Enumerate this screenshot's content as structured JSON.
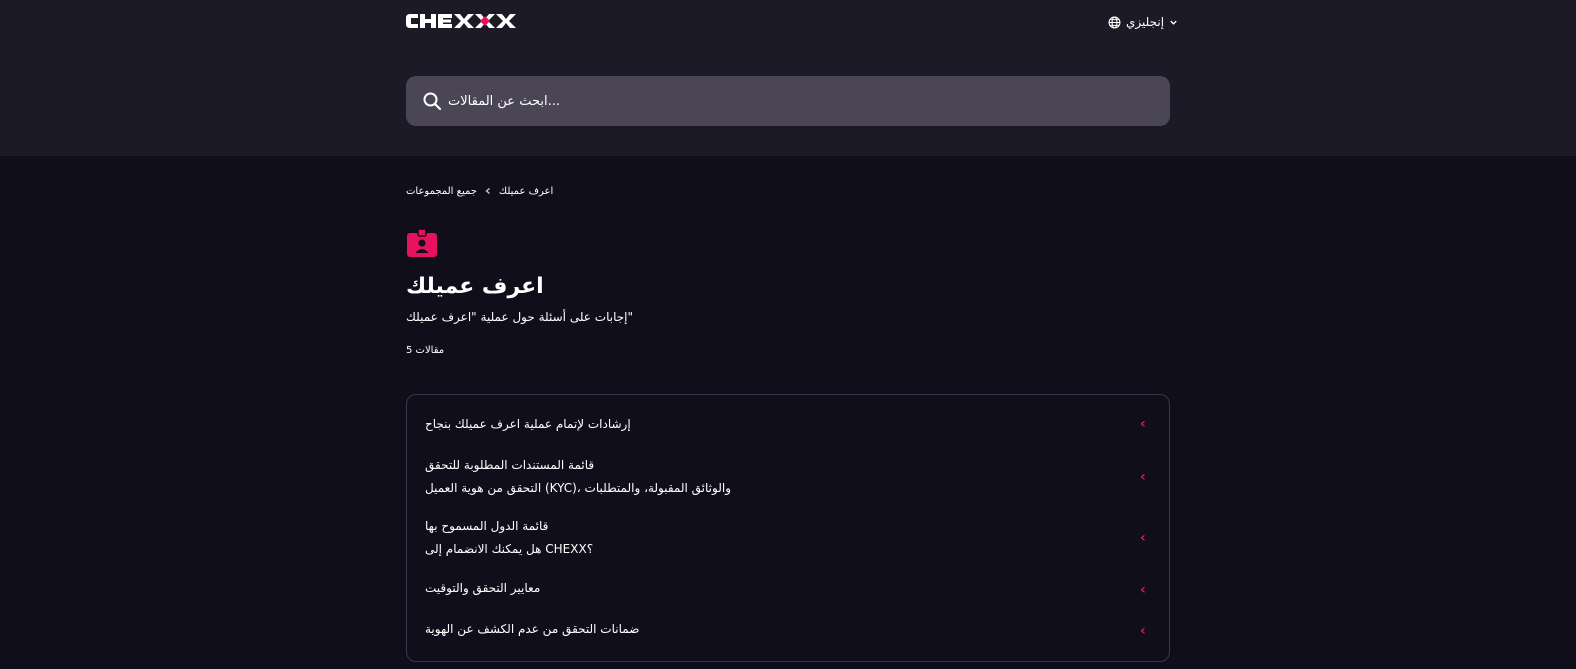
{
  "header": {
    "language": "إنجليزي",
    "search_placeholder": "ابحث عن المقالات..."
  },
  "breadcrumbs": [
    "جميع المجموعات",
    "اعرف عميلك"
  ],
  "category": {
    "title": "اعرف عميلك",
    "subtitle": "إجابات على أسئلة حول عملية \"اعرف عميلك\"",
    "count": "5 مقالات"
  },
  "articles": [
    {
      "title": "إرشادات لإتمام عملية اعرف عميلك بنجاح",
      "description": ""
    },
    {
      "title": "قائمة المستندات المطلوبة للتحقق",
      "description": "التحقق من هوية العميل (KYC)، والوثائق المقبولة، والمتطلبات"
    },
    {
      "title": "قائمة الدول المسموح بها",
      "description": "هل يمكنك الانضمام إلى CHEXX؟"
    },
    {
      "title": "معايير التحقق والتوقيت",
      "description": ""
    },
    {
      "title": "ضمانات التحقق من عدم الكشف عن الهوية",
      "description": ""
    }
  ],
  "icons": {
    "logo": "chexx-logo",
    "language": "globe-icon",
    "language_toggle": "chevron-down-icon",
    "search": "search-icon",
    "breadcrumb_separator": "chevron-left-icon",
    "category": "id-badge-icon",
    "article_arrow": "chevron-left-icon"
  },
  "colors": {
    "accent": "#e8115d",
    "header_bg": "#1d1a28",
    "page_bg": "#110e1b",
    "search_bg": "#4a4656"
  }
}
